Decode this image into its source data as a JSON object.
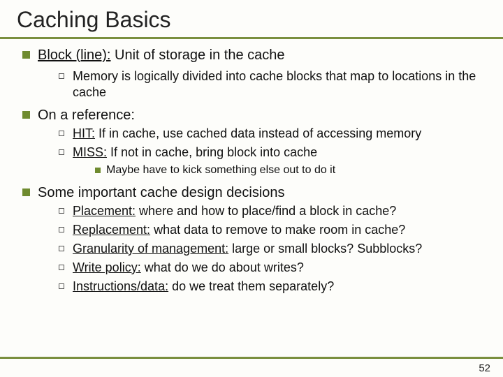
{
  "title": "Caching Basics",
  "page_number": "52",
  "bullets": {
    "b0": {
      "lead": "Block (line):",
      "rest": " Unit of storage in the cache"
    },
    "b0s0": "Memory is logically divided into cache blocks that map to locations in the cache",
    "b1": "On a reference:",
    "b1s0": {
      "lead": "HIT:",
      "rest": " If in cache, use cached data instead of accessing memory"
    },
    "b1s1": {
      "lead": "MISS:",
      "rest": " If not in cache, bring block into cache"
    },
    "b1s1t0": "Maybe have to kick something else out to do it",
    "b2": "Some important cache design decisions",
    "b2s0": {
      "lead": "Placement:",
      "rest": " where and how to place/find a block in cache?"
    },
    "b2s1": {
      "lead": "Replacement:",
      "rest": " what data to remove to make room in cache?"
    },
    "b2s2": {
      "lead": "Granularity of management:",
      "rest": " large or small blocks? Subblocks?"
    },
    "b2s3": {
      "lead": "Write policy:",
      "rest": " what do we do about writes?"
    },
    "b2s4": {
      "lead": "Instructions/data:",
      "rest": " do we treat them separately?"
    }
  }
}
